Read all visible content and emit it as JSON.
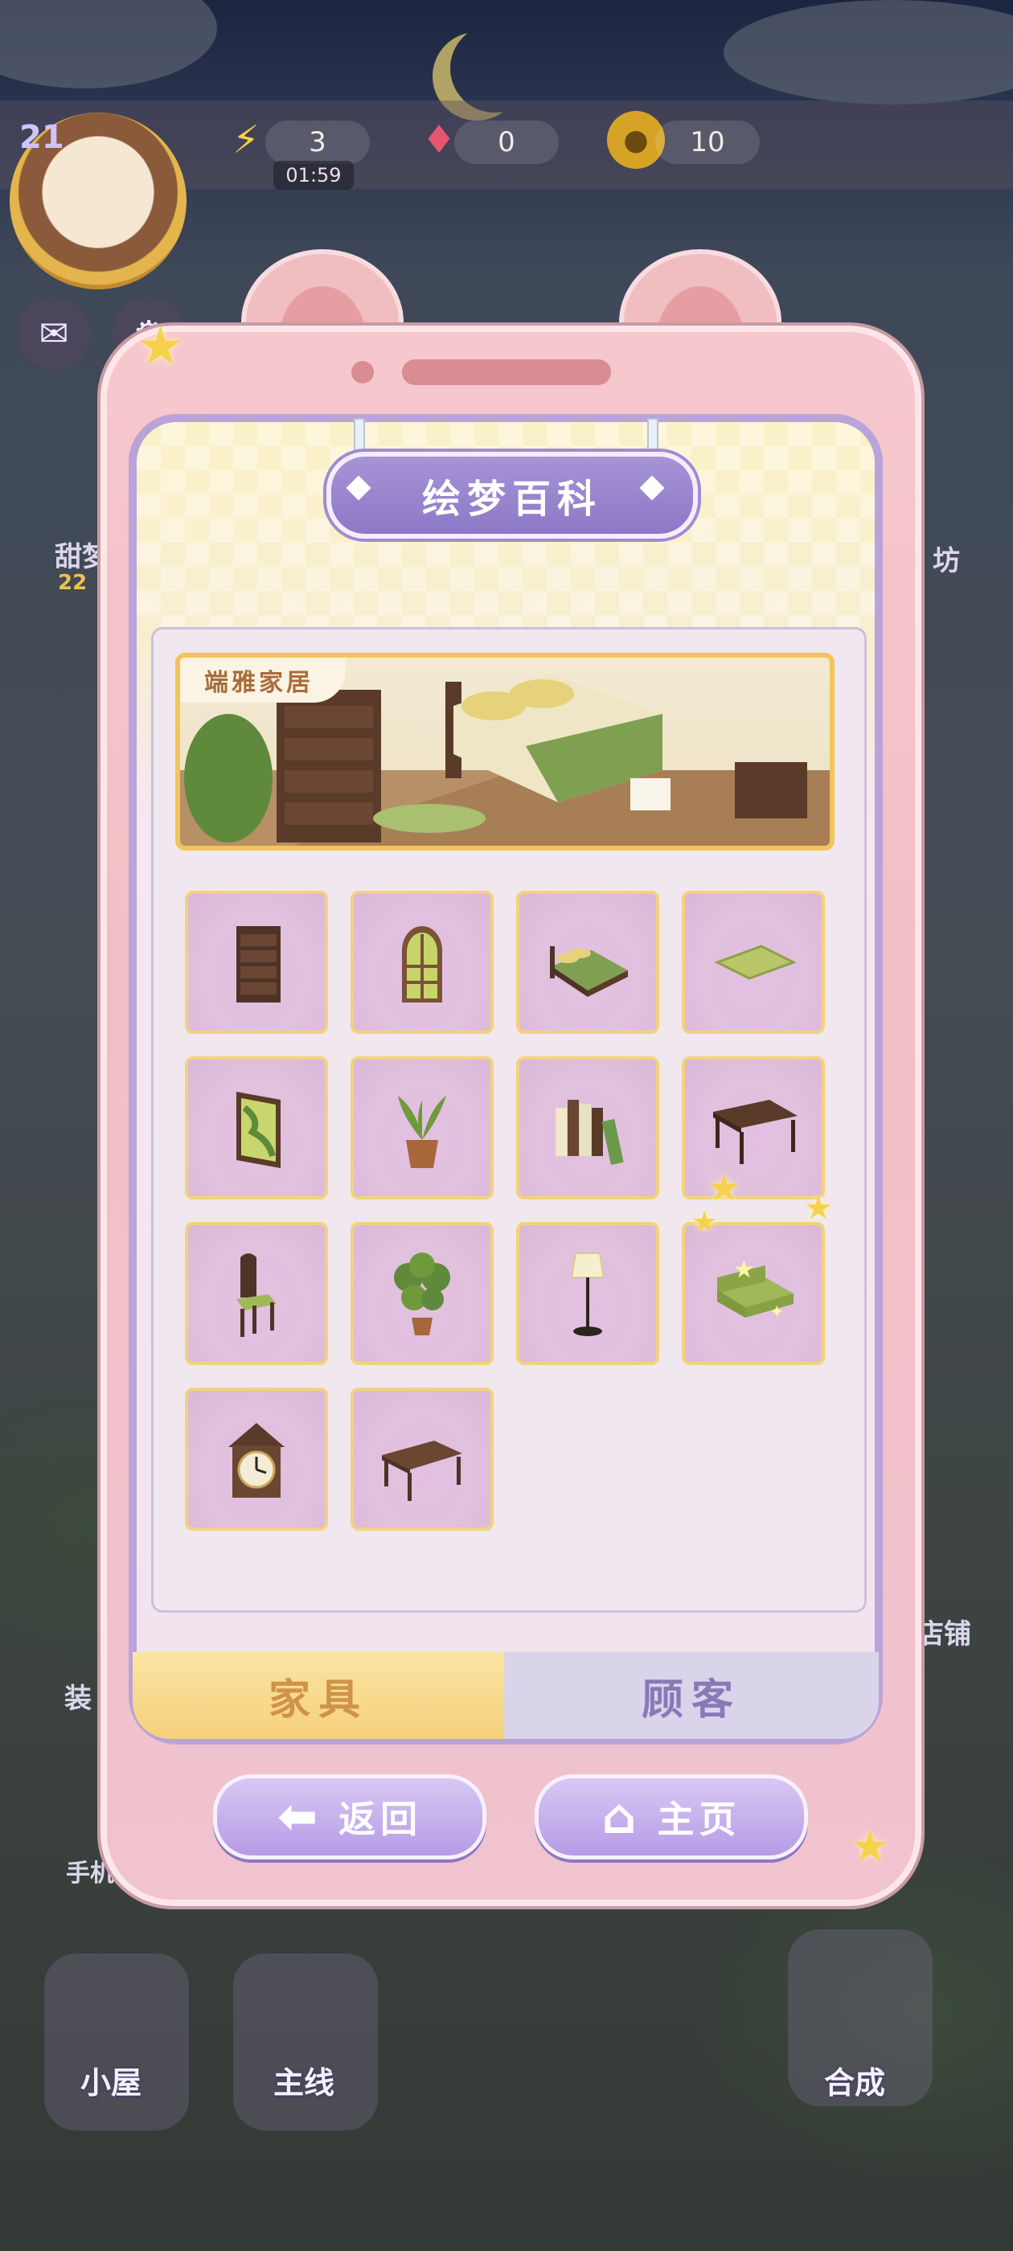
{
  "hud": {
    "level": "21",
    "energy": {
      "value": "3",
      "timer": "01:59",
      "icon": "lightning-icon"
    },
    "gems": {
      "value": "0",
      "icon": "gem-icon"
    },
    "coins": {
      "value": "10",
      "icon": "coin-icon"
    }
  },
  "background": {
    "left_labels": [
      "甜梦",
      "22",
      "装",
      "手机"
    ],
    "right_labels": [
      "坊",
      "店铺"
    ],
    "bottom_nav": [
      "小屋",
      "主线",
      "合成"
    ]
  },
  "encyclopedia": {
    "title": "绘梦百科",
    "banner_tag": "端雅家居",
    "items": [
      {
        "name": "dresser",
        "icon": "dresser-icon"
      },
      {
        "name": "arched-window",
        "icon": "window-icon"
      },
      {
        "name": "bed",
        "icon": "bed-icon"
      },
      {
        "name": "rug",
        "icon": "rug-icon"
      },
      {
        "name": "wall-painting",
        "icon": "painting-icon"
      },
      {
        "name": "potted-plant-small",
        "icon": "plant-icon"
      },
      {
        "name": "books",
        "icon": "books-icon"
      },
      {
        "name": "desk",
        "icon": "desk-icon"
      },
      {
        "name": "chair",
        "icon": "chair-icon"
      },
      {
        "name": "monstera-plant",
        "icon": "monstera-icon"
      },
      {
        "name": "floor-lamp",
        "icon": "lamp-icon"
      },
      {
        "name": "sofa",
        "icon": "sofa-icon",
        "new": true
      },
      {
        "name": "cuckoo-clock",
        "icon": "clock-icon"
      },
      {
        "name": "coffee-table",
        "icon": "table-icon"
      }
    ],
    "tabs": [
      {
        "label": "家具",
        "active": true
      },
      {
        "label": "顾客",
        "active": false
      }
    ],
    "buttons": {
      "back": "返回",
      "home": "主页"
    }
  },
  "colors": {
    "panel_pink": "#f2bec5",
    "accent_purple": "#a694d6",
    "slot_gold": "#f3d37a",
    "tab_gold": "#f5d17c"
  }
}
